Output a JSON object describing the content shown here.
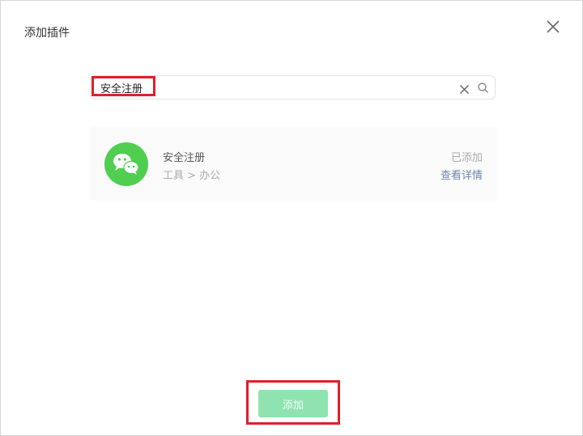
{
  "dialog": {
    "title": "添加插件",
    "close_icon": "close-icon"
  },
  "search": {
    "value": "安全注册",
    "clear_icon": "clear-icon",
    "search_icon": "search-icon"
  },
  "results": [
    {
      "avatar_icon": "wechat-icon",
      "name": "安全注册",
      "category": "工具 > 办公",
      "status": "已添加",
      "details_link": "查看详情"
    }
  ],
  "footer": {
    "add_label": "添加"
  },
  "colors": {
    "accent_green": "#4fce4f",
    "button_disabled": "#8ee3b0",
    "highlight_red": "#e01f2b",
    "link": "#6d88a8"
  }
}
